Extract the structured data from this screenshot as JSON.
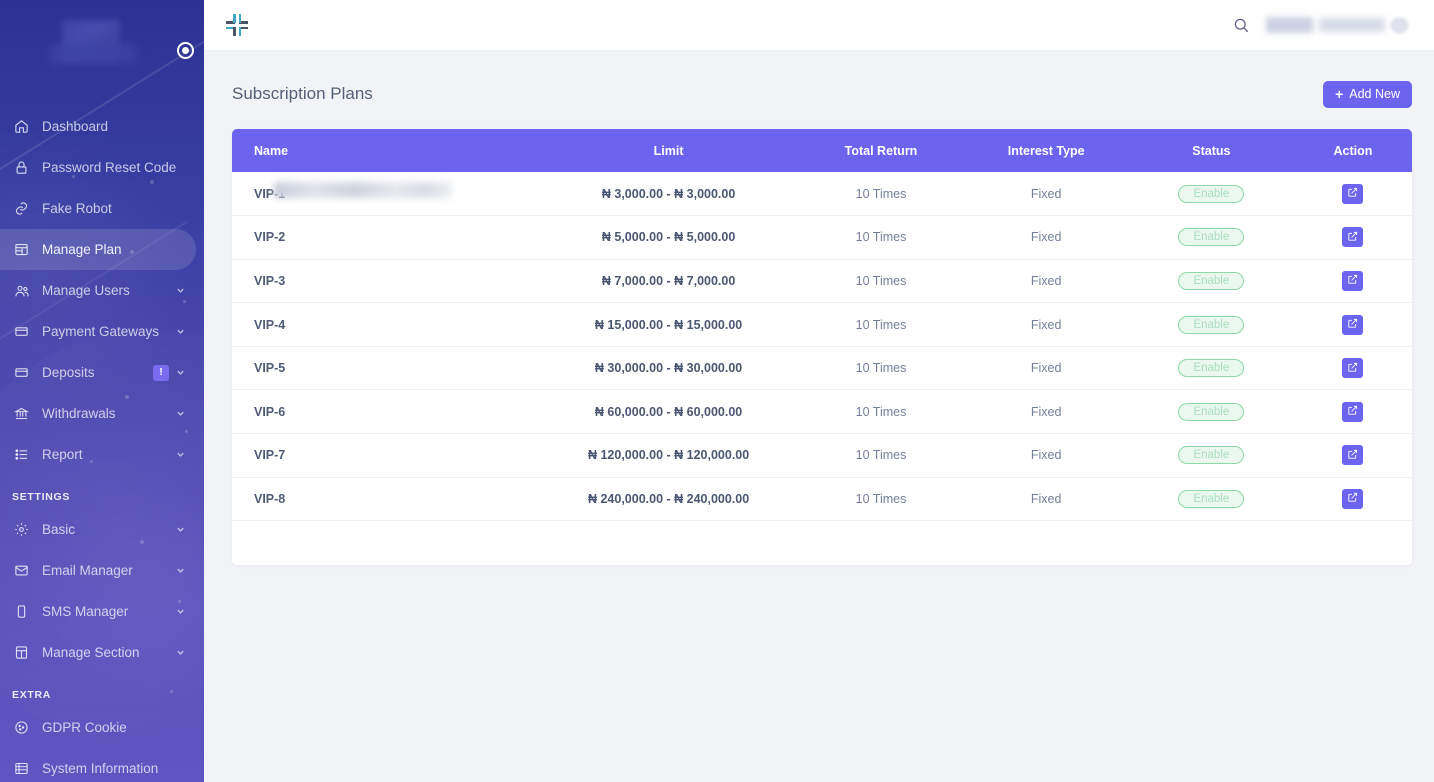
{
  "sidebar": {
    "logo_alt": "site-logo-blurred",
    "toggle_icon": "radio-circle-icon",
    "items": [
      {
        "label": "Dashboard",
        "icon": "home-icon",
        "has_chevron": false,
        "active": false
      },
      {
        "label": "Password Reset Code",
        "icon": "lock-icon",
        "has_chevron": false,
        "active": false
      },
      {
        "label": "Fake Robot",
        "icon": "link-icon",
        "has_chevron": false,
        "active": false
      },
      {
        "label": "Manage Plan",
        "icon": "table-icon",
        "has_chevron": false,
        "active": true
      },
      {
        "label": "Manage Users",
        "icon": "users-icon",
        "has_chevron": true,
        "active": false
      },
      {
        "label": "Payment Gateways",
        "icon": "card-icon",
        "has_chevron": true,
        "active": false
      },
      {
        "label": "Deposits",
        "icon": "card-icon",
        "has_chevron": true,
        "active": false,
        "badge": "!"
      },
      {
        "label": "Withdrawals",
        "icon": "bank-icon",
        "has_chevron": true,
        "active": false
      },
      {
        "label": "Report",
        "icon": "list-icon",
        "has_chevron": true,
        "active": false
      }
    ],
    "settings_section": "SETTINGS",
    "settings_items": [
      {
        "label": "Basic",
        "icon": "gear-icon",
        "has_chevron": true
      },
      {
        "label": "Email Manager",
        "icon": "envelope-icon",
        "has_chevron": true
      },
      {
        "label": "SMS Manager",
        "icon": "mobile-icon",
        "has_chevron": true
      },
      {
        "label": "Manage Section",
        "icon": "columns-icon",
        "has_chevron": true
      }
    ],
    "extra_section": "EXTRA",
    "extra_items": [
      {
        "label": "GDPR Cookie",
        "icon": "cookie-icon",
        "has_chevron": false
      },
      {
        "label": "System Information",
        "icon": "server-icon",
        "has_chevron": false
      }
    ]
  },
  "topbar": {
    "collapse_icon": "compress-icon",
    "search_icon": "search-icon",
    "user_name_redacted": true
  },
  "page": {
    "title": "Subscription Plans",
    "add_button": "Add New",
    "add_button_icon": "plus-icon"
  },
  "table": {
    "columns": [
      "Name",
      "Limit",
      "Total Return",
      "Interest Type",
      "Status",
      "Action"
    ],
    "edit_icon": "edit-square-icon",
    "rows": [
      {
        "name": "VIP-1",
        "redacted": true,
        "limit": "₦ 3,000.00 - ₦ 3,000.00",
        "total_return": "10 Times",
        "interest_type": "Fixed",
        "status": "Enable",
        "action": "edit"
      },
      {
        "name": "VIP-2",
        "redacted": false,
        "limit": "₦ 5,000.00 - ₦ 5,000.00",
        "total_return": "10 Times",
        "interest_type": "Fixed",
        "status": "Enable",
        "action": "edit"
      },
      {
        "name": "VIP-3",
        "redacted": false,
        "limit": "₦ 7,000.00 - ₦ 7,000.00",
        "total_return": "10 Times",
        "interest_type": "Fixed",
        "status": "Enable",
        "action": "edit"
      },
      {
        "name": "VIP-4",
        "redacted": false,
        "limit": "₦ 15,000.00 - ₦ 15,000.00",
        "total_return": "10 Times",
        "interest_type": "Fixed",
        "status": "Enable",
        "action": "edit"
      },
      {
        "name": "VIP-5",
        "redacted": false,
        "limit": "₦ 30,000.00 - ₦ 30,000.00",
        "total_return": "10 Times",
        "interest_type": "Fixed",
        "status": "Enable",
        "action": "edit"
      },
      {
        "name": "VIP-6",
        "redacted": false,
        "limit": "₦ 60,000.00 - ₦ 60,000.00",
        "total_return": "10 Times",
        "interest_type": "Fixed",
        "status": "Enable",
        "action": "edit"
      },
      {
        "name": "VIP-7",
        "redacted": false,
        "limit": "₦ 120,000.00 - ₦ 120,000.00",
        "total_return": "10 Times",
        "interest_type": "Fixed",
        "status": "Enable",
        "action": "edit"
      },
      {
        "name": "VIP-8",
        "redacted": false,
        "limit": "₦ 240,000.00 - ₦ 240,000.00",
        "total_return": "10 Times",
        "interest_type": "Fixed",
        "status": "Enable",
        "action": "edit"
      }
    ]
  },
  "colors": {
    "accent": "#6C63EF",
    "sidebar_top": "#2E3192",
    "sidebar_bottom": "#5E55C0",
    "page_bg": "#F2F3F7",
    "status_green_border": "#8FD8A8",
    "status_green_bg": "#EAF8EF",
    "status_green_text": "#A9DFBE"
  }
}
